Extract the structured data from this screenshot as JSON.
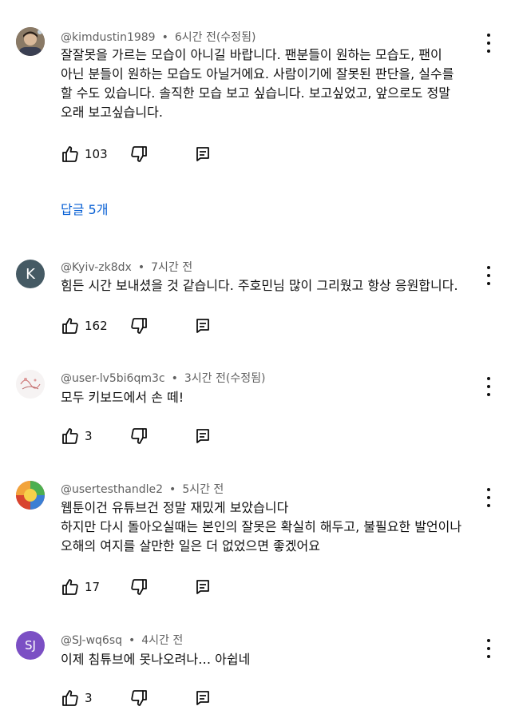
{
  "comments": [
    {
      "author": "@kimdustin1989",
      "time": "6시간 전(수정됨)",
      "lines": [
        "잘잘못을 가르는 모습이 아니길 바랍니다. 팬분들이 원하는 모습도, 팬이",
        "아닌 분들이 원하는 모습도 아닐거에요. 사람이기에 잘못된 판단을, 실수를",
        "할 수도 있습니다. 솔직한 모습 보고 싶습니다. 보고싶었고, 앞으로도 정말",
        "오래 보고싶습니다."
      ],
      "likes": "103",
      "replies_label": "답글 5개"
    },
    {
      "author": "@Kyiv-zk8dx",
      "time": "7시간 전",
      "avatar_letter": "K",
      "lines": [
        "힘든 시간 보내셨을 것 같습니다. 주호민님 많이 그리웠고 항상 응원합니다."
      ],
      "likes": "162"
    },
    {
      "author": "@user-lv5bi6qm3c",
      "time": "3시간 전(수정됨)",
      "lines": [
        "모두 키보드에서 손 떼!"
      ],
      "likes": "3"
    },
    {
      "author": "@usertesthandle2",
      "time": "5시간 전",
      "lines": [
        "웹툰이건 유튜브건 정말 재밌게 보았습니다",
        "하지만 다시 돌아오실때는 본인의 잘못은 확실히 해두고, 불필요한 발언이나",
        "오해의 여지를 살만한 일은 더 없었으면 좋겠어요"
      ],
      "likes": "17"
    },
    {
      "author": "@SJ-wq6sq",
      "time": "4시간 전",
      "avatar_letter": "SJ",
      "lines": [
        "이제 침튜브에 못나오려나… 아쉽네"
      ],
      "likes": "3"
    }
  ],
  "colors": {
    "meta": "#606060",
    "link": "#065fd4",
    "avatar_k": "#455a64",
    "avatar_sj": "#7b4fc4"
  },
  "icons": {
    "like": "thumbs-up-icon",
    "dislike": "thumbs-down-icon",
    "reply": "comment-reply-icon",
    "more": "more-vertical-icon"
  }
}
